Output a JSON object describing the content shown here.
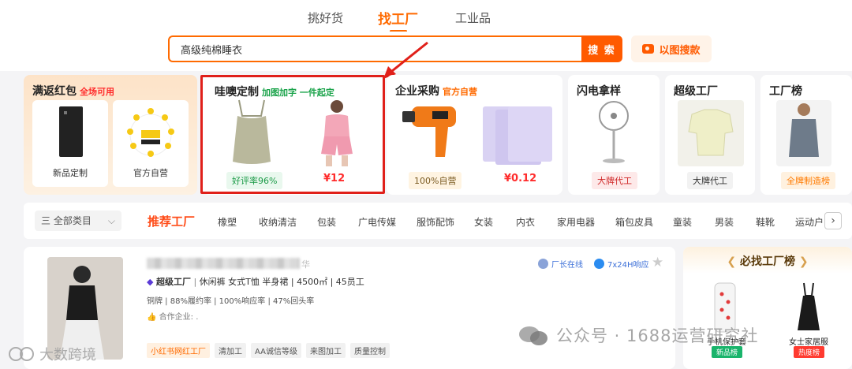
{
  "nav": {
    "tabs": [
      "挑好货",
      "找工厂",
      "工业品"
    ],
    "active_index": 1
  },
  "search": {
    "value": "高级纯棉睡衣",
    "button_label": "搜 索",
    "image_search_label": "以图搜款"
  },
  "cards": {
    "hongbao": {
      "title": "满返红包",
      "subtitle": "全场可用",
      "items": [
        "新品定制",
        "官方自营"
      ]
    },
    "custom": {
      "title": "哇噢定制",
      "subtitle": "加图加字 一件起定",
      "badge": "好评率96%",
      "price": "¥12"
    },
    "enterprise": {
      "title": "企业采购",
      "subtitle": "官方自营",
      "badge": "100%自营",
      "price": "¥0.12"
    },
    "sample": {
      "title": "闪电拿样",
      "badge": "大牌代工"
    },
    "super_factory": {
      "title": "超级工厂",
      "badge": "大牌代工"
    },
    "factory_rank": {
      "title": "工厂榜",
      "badge": "全牌制造榜"
    }
  },
  "categories": {
    "all_label": "三 全部类目",
    "items": [
      "推荐工厂",
      "橡塑",
      "收纳清洁",
      "包装",
      "广电传媒",
      "服饰配饰",
      "女装",
      "内衣",
      "家用电器",
      "箱包皮具",
      "童装",
      "男装",
      "鞋靴",
      "运动户"
    ]
  },
  "listing": {
    "name_suffix": "华",
    "online": "厂长在线",
    "response": "7x24H响应",
    "level": "超级工厂",
    "details": "休闲裤 女式T恤 半身裙 | 4500㎡ | 45员工",
    "stats": "铜牌 | 88%履约率 | 100%响应率 | 47%回头率",
    "partners": "合作企业: .",
    "tags": [
      "小红书网红工厂",
      "清加工",
      "AA诚信等级",
      "来图加工",
      "质量控制"
    ]
  },
  "rank_panel": {
    "title": "必找工厂榜",
    "items": [
      {
        "caption": "手机保护套",
        "tag": "新品榜",
        "tag_color": "#19b46b"
      },
      {
        "caption": "女士家居服",
        "tag": "热度榜",
        "tag_color": "#ff3b30"
      }
    ]
  },
  "watermarks": {
    "wechat": "公众号 · 1688运营研究社",
    "corner": "大数跨境"
  },
  "colors": {
    "accent": "#ff6a00",
    "highlight_red": "#e0201a"
  }
}
